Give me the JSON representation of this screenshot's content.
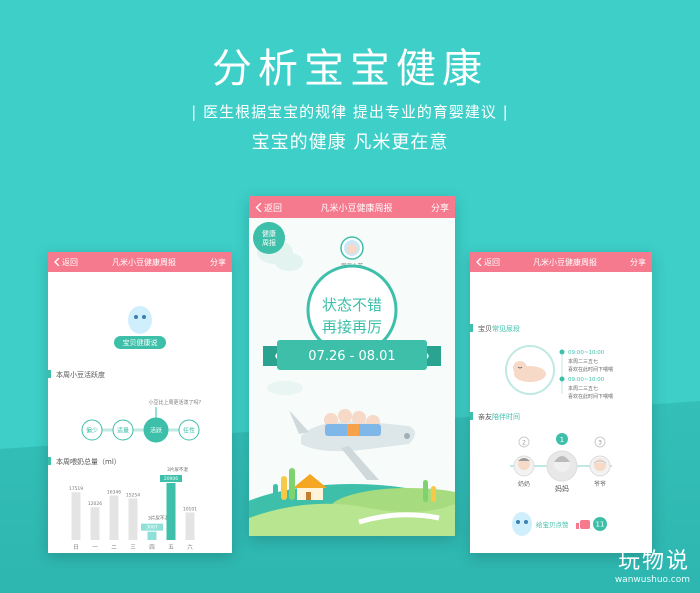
{
  "hero": {
    "title": "分析宝宝健康",
    "subtitle": "| 医生根据宝宝的规律 提出专业的育婴建议 |",
    "slogan": "宝宝的健康 凡米更在意"
  },
  "left_phone": {
    "header": {
      "back": "返回",
      "title": "凡米小豆健康周报",
      "share": "分享"
    },
    "mascot_label": "宝贝健康说",
    "activity_title": "本周小豆活跃度",
    "activity_question": "小豆比上周更活泼了吗？",
    "activity_levels": [
      "偏少",
      "适量",
      "活跃",
      "任性"
    ],
    "activity_selected": "活跃",
    "milk_title": "本周喂奶总量（ml）"
  },
  "center_phone": {
    "header": {
      "back": "返回",
      "title": "凡米小豆健康周报",
      "share": "分享"
    },
    "tag": "健康\n周报",
    "avatar_name": "凤豆小花",
    "status_line1": "状态不错",
    "status_line2": "再接再厉",
    "date_range": "07.26 - 08.01"
  },
  "right_phone": {
    "header": {
      "back": "返回",
      "title": "凡米小豆健康周报",
      "share": "分享"
    },
    "sleep_title_prefix": "宝贝",
    "sleep_title_highlight": "常见尿段",
    "sleep_items": [
      {
        "time": "09:00~10:00",
        "line1": "本周二三五七",
        "line2": "喜欢在此时间下喂喂"
      },
      {
        "time": "09:00~10:00",
        "line1": "本周二三五七",
        "line2": "喜欢在此时间下喂喂"
      }
    ],
    "family_title_prefix": "亲友",
    "family_title_highlight": "陪伴时间",
    "ranks": [
      "2",
      "1",
      "3"
    ],
    "family": [
      {
        "name": "奶奶"
      },
      {
        "name": "妈妈"
      },
      {
        "name": "爷爷"
      }
    ],
    "like_label": "给宝贝点赞",
    "like_count": "11"
  },
  "chart_data": {
    "type": "bar",
    "title": "本周喂奶总量（ml）",
    "categories": [
      "日",
      "一",
      "二",
      "三",
      "四",
      "五",
      "六"
    ],
    "values": [
      17519,
      12026,
      16346,
      15254,
      3067,
      20906,
      10101
    ],
    "highlights": [
      {
        "category": "四",
        "label": "3片尿不湿"
      },
      {
        "category": "五",
        "label": "3片尿不湿"
      }
    ],
    "colors": {
      "normal": "#e4e4e4",
      "low": "#8fe0d8",
      "high": "#3dbfa9"
    }
  },
  "colors": {
    "background": "#3dcfc8",
    "header": "#f57a8e",
    "accent": "#3dbfa9"
  },
  "watermark": {
    "logo": "玩物说",
    "url": "wanwushuo.com"
  }
}
